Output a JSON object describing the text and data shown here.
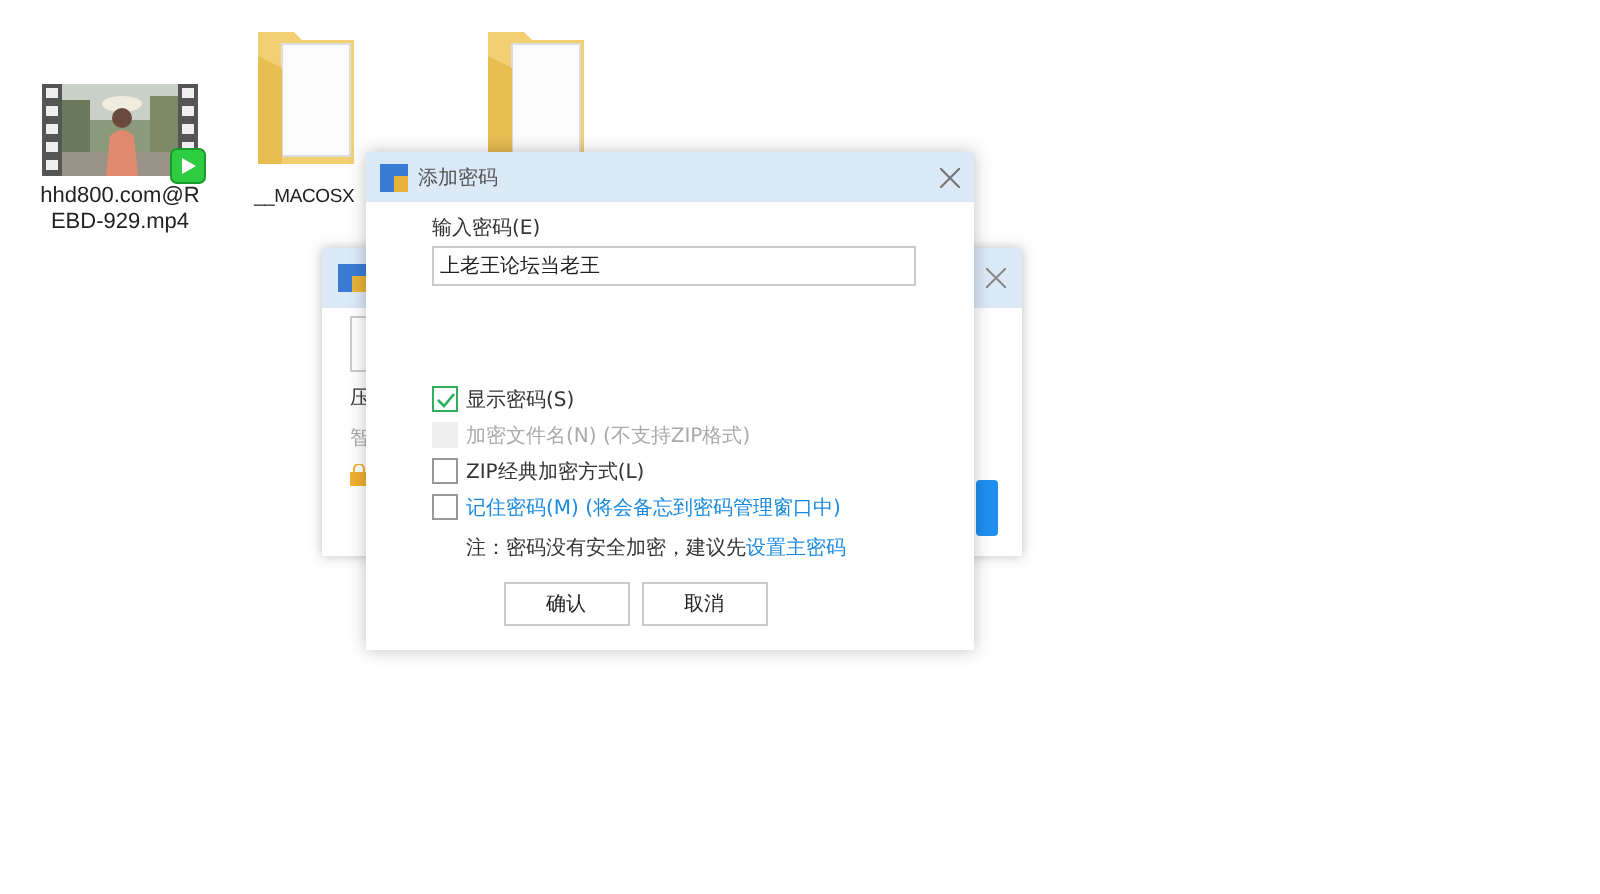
{
  "desktop_icons": [
    {
      "kind": "video",
      "label": "hhd800.com@REBD-929.mp4"
    },
    {
      "kind": "folder",
      "label": "__MACOSX"
    },
    {
      "kind": "folder"
    }
  ],
  "back_window": {
    "row_label": "压",
    "hint": "智"
  },
  "dialog": {
    "title": "添加密码",
    "password_label": "输入密码(E)",
    "password": "上老王论坛当老王",
    "options": [
      {
        "kind": "plain",
        "label": "显示密码(S)",
        "checked": true,
        "disabled": false
      },
      {
        "kind": "plain",
        "label": "加密文件名(N) (不支持ZIP格式)",
        "checked": false,
        "disabled": true
      },
      {
        "kind": "plain",
        "label": "ZIP经典加密方式(L)",
        "checked": false,
        "disabled": false
      },
      {
        "kind": "link",
        "label": "记住密码(M) (将会备忘到密码管理窗口中)",
        "checked": false,
        "disabled": false
      }
    ],
    "note": "注：密码没有安全加密，建议先",
    "note_link": "设置主密码",
    "buttons": [
      "确认",
      "取消"
    ]
  }
}
